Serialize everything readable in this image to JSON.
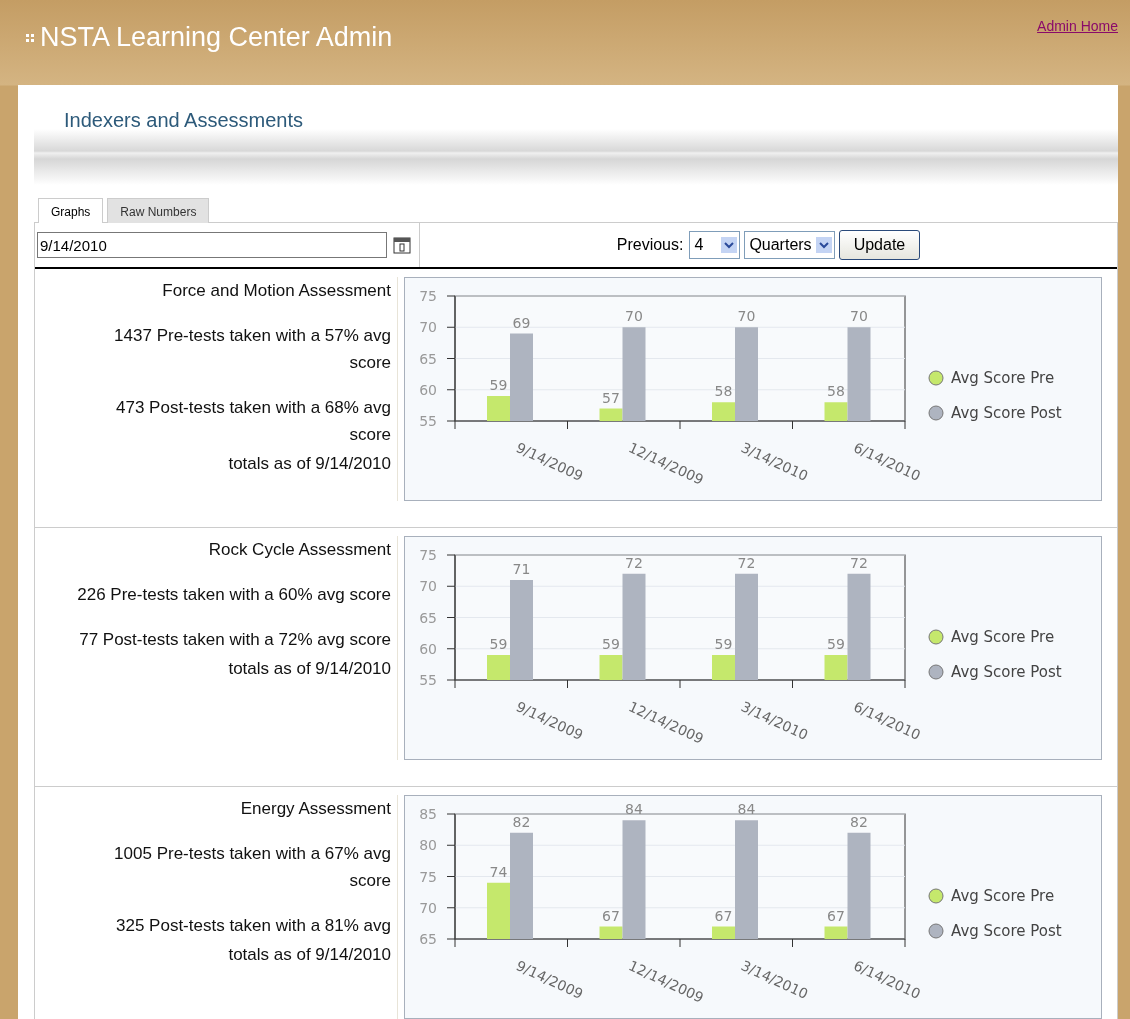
{
  "header": {
    "title": "NSTA Learning Center Admin",
    "link": "Admin Home"
  },
  "section_title": "Indexers and Assessments",
  "tabs": [
    {
      "label": "Graphs",
      "selected": true
    },
    {
      "label": "Raw Numbers",
      "selected": false
    }
  ],
  "date_field": {
    "value": "9/14/2010"
  },
  "controls": {
    "label": "Previous:",
    "count": "4",
    "unit": "Quarters",
    "button": "Update"
  },
  "assessments": [
    {
      "name": "Force and Motion Assessment",
      "pre": "1437 Pre-tests taken with a 57% avg score",
      "post": "473 Post-tests taken with a 68% avg score",
      "totals": "totals as of 9/14/2010",
      "chart_data": {
        "type": "bar",
        "categories": [
          "9/14/2009",
          "12/14/2009",
          "3/14/2010",
          "6/14/2010"
        ],
        "ylim": [
          55,
          75
        ],
        "yticks": [
          55,
          60,
          65,
          70,
          75
        ],
        "data_labels": true,
        "grid": true,
        "legend": true,
        "series": [
          {
            "name": "Avg Score Pre",
            "color": "#c5e86c",
            "values": [
              59,
              57,
              58,
              58
            ]
          },
          {
            "name": "Avg Score Post",
            "color": "#aeb4c0",
            "values": [
              69,
              70,
              70,
              70
            ]
          }
        ]
      }
    },
    {
      "name": "Rock Cycle Assessment",
      "pre": "226 Pre-tests taken with a 60% avg score",
      "post": "77 Post-tests taken with a 72% avg score",
      "totals": "totals as of 9/14/2010",
      "chart_data": {
        "type": "bar",
        "categories": [
          "9/14/2009",
          "12/14/2009",
          "3/14/2010",
          "6/14/2010"
        ],
        "ylim": [
          55,
          75
        ],
        "yticks": [
          55,
          60,
          65,
          70,
          75
        ],
        "data_labels": true,
        "grid": true,
        "legend": true,
        "series": [
          {
            "name": "Avg Score Pre",
            "color": "#c5e86c",
            "values": [
              59,
              59,
              59,
              59
            ]
          },
          {
            "name": "Avg Score Post",
            "color": "#aeb4c0",
            "values": [
              71,
              72,
              72,
              72
            ]
          }
        ]
      }
    },
    {
      "name": "Energy Assessment",
      "pre": "1005 Pre-tests taken with a 67% avg score",
      "post": "325 Post-tests taken with a 81% avg",
      "totals": "totals as of 9/14/2010",
      "chart_data": {
        "type": "bar",
        "categories": [
          "9/14/2009",
          "12/14/2009",
          "3/14/2010",
          "6/14/2010"
        ],
        "ylim": [
          65,
          85
        ],
        "yticks": [
          65,
          70,
          75,
          80,
          85
        ],
        "data_labels": true,
        "grid": true,
        "legend": true,
        "series": [
          {
            "name": "Avg Score Pre",
            "color": "#c5e86c",
            "values": [
              74,
              67,
              67,
              67
            ]
          },
          {
            "name": "Avg Score Post",
            "color": "#aeb4c0",
            "values": [
              82,
              84,
              84,
              82
            ]
          }
        ]
      }
    }
  ]
}
